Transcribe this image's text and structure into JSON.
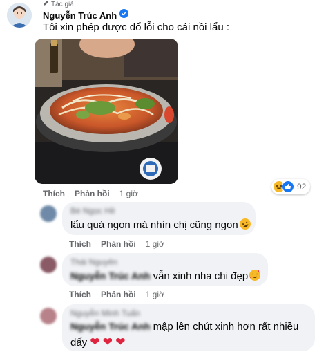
{
  "main_comment": {
    "badge": "Tác giả",
    "author": "Nguyễn Trúc Anh",
    "text": "Tôi xin phép được đổ lỗi cho cái nồi lẩu :",
    "like": "Thích",
    "reply": "Phản hồi",
    "time": "1 giờ",
    "reaction_count": "92",
    "reactions": [
      "haha-icon",
      "like-icon"
    ],
    "verified": "verified-icon"
  },
  "replies": [
    {
      "author": "Bé Ngọc Hề",
      "text": "lẩu quá ngon mà nhìn chị cũng ngon",
      "emoji": "rofl-emoji",
      "like": "Thích",
      "reply": "Phản hồi",
      "time": "1 giờ"
    },
    {
      "author": "Thái Nguyên",
      "mention": "Nguyễn Trúc Anh",
      "text": "vẫn xinh nha chi đẹp",
      "emoji": "smiling-hearts-emoji",
      "like": "Thích",
      "reply": "Phản hồi",
      "time": "1 giờ"
    },
    {
      "author": "Nguyễn Minh Tuấn",
      "mention": "Nguyễn Trúc Anh",
      "text": "mập lên chút xinh hơn rất nhiều",
      "text2": "đấy",
      "hearts": [
        "❤",
        "❤",
        "❤"
      ]
    }
  ],
  "colors": {
    "bubble": "#f0f2f5",
    "meta": "#65676b",
    "like_blue": "#1877f2",
    "heart_red": "#e02440"
  }
}
